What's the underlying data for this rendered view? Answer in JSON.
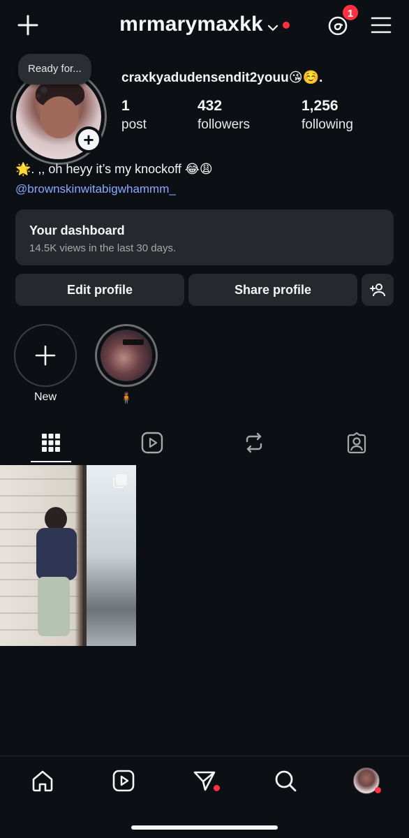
{
  "header": {
    "username": "mrmarymaxkk",
    "threads_badge": "1",
    "accent_red": "#ff3040"
  },
  "profile": {
    "note": "Ready for...",
    "display_name": "craxkyadudensendit2youu😘☺️.",
    "stats": [
      {
        "value": "1",
        "label": "post"
      },
      {
        "value": "432",
        "label": "followers"
      },
      {
        "value": "1,256",
        "label": "following"
      }
    ],
    "bio": "🌟. ,, oh heyy it’s my knockoff 😂😩",
    "bio_link": "@brownskinwitabigwhammm_",
    "link_color": "#8aa8ff"
  },
  "dashboard": {
    "title": "Your dashboard",
    "subtitle": "14.5K views in the last 30 days."
  },
  "actions": {
    "edit": "Edit profile",
    "share": "Share profile"
  },
  "highlights": [
    {
      "label": "New"
    },
    {
      "label": "🧍🏾"
    }
  ],
  "tabs": [
    "grid-icon",
    "reels-icon",
    "reposts-icon",
    "tagged-icon"
  ],
  "bottom_nav": [
    "home-icon",
    "reels-icon",
    "messages-icon",
    "search-icon",
    "profile-avatar"
  ]
}
